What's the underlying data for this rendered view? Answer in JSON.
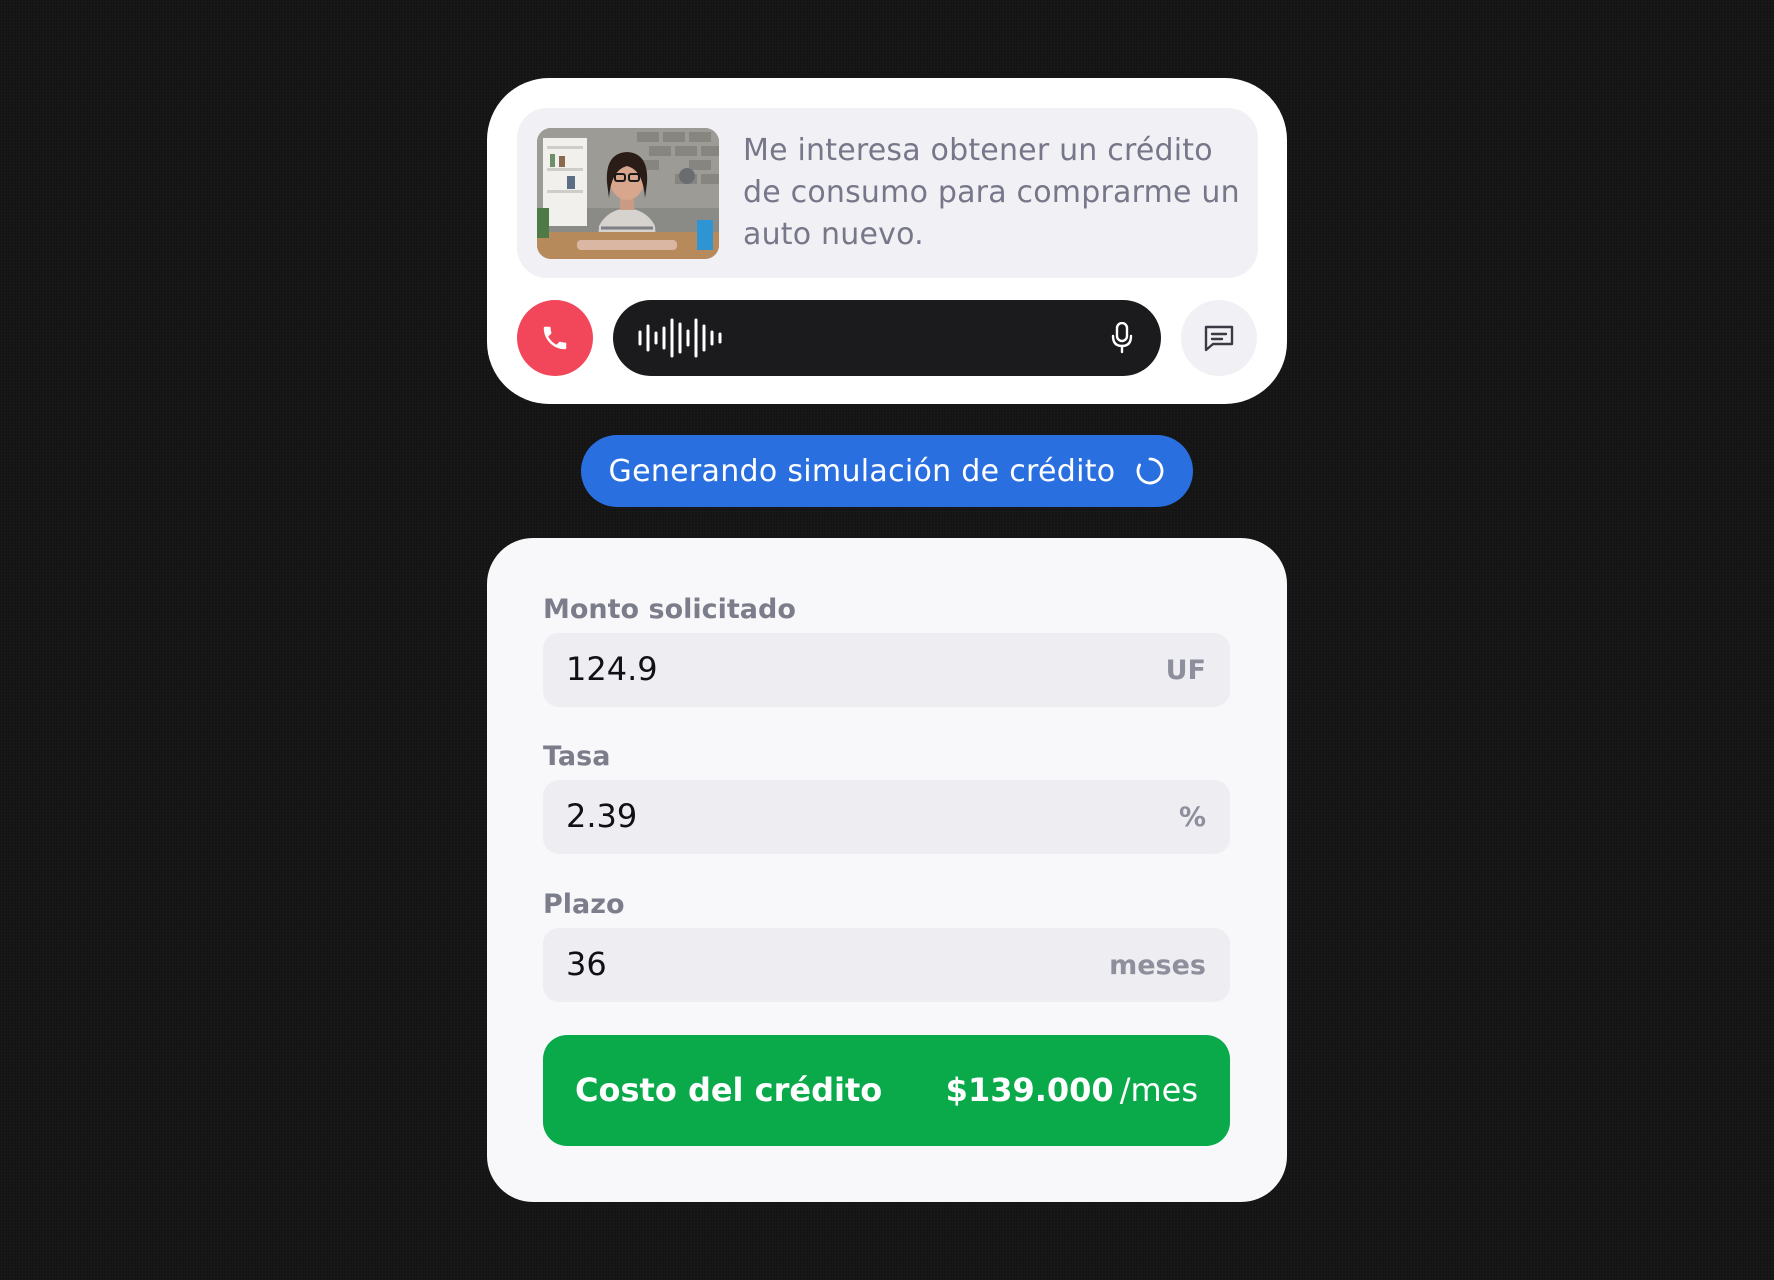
{
  "call": {
    "transcript": "Me interesa obtener un crédito de consumo para comprarme un auto nuevo.",
    "icons": {
      "end_call": "phone-icon",
      "waveform": "waveform-icon",
      "mic": "microphone-icon",
      "chat": "chat-icon"
    }
  },
  "status": {
    "text": "Generando simulación de crédito",
    "icon": "spinner-icon"
  },
  "simulation": {
    "fields": [
      {
        "label": "Monto solicitado",
        "value": "124.9",
        "unit": "UF"
      },
      {
        "label": "Tasa",
        "value": "2.39",
        "unit": "%"
      },
      {
        "label": "Plazo",
        "value": "36",
        "unit": "meses"
      }
    ],
    "cost": {
      "label": "Costo del crédito",
      "amount": "$139.000",
      "period": "/mes"
    }
  },
  "colors": {
    "end_call": "#f2475a",
    "status_pill": "#2a6fe0",
    "cost_button": "#0aaa4b",
    "audio_bar": "#1b1b1e"
  }
}
